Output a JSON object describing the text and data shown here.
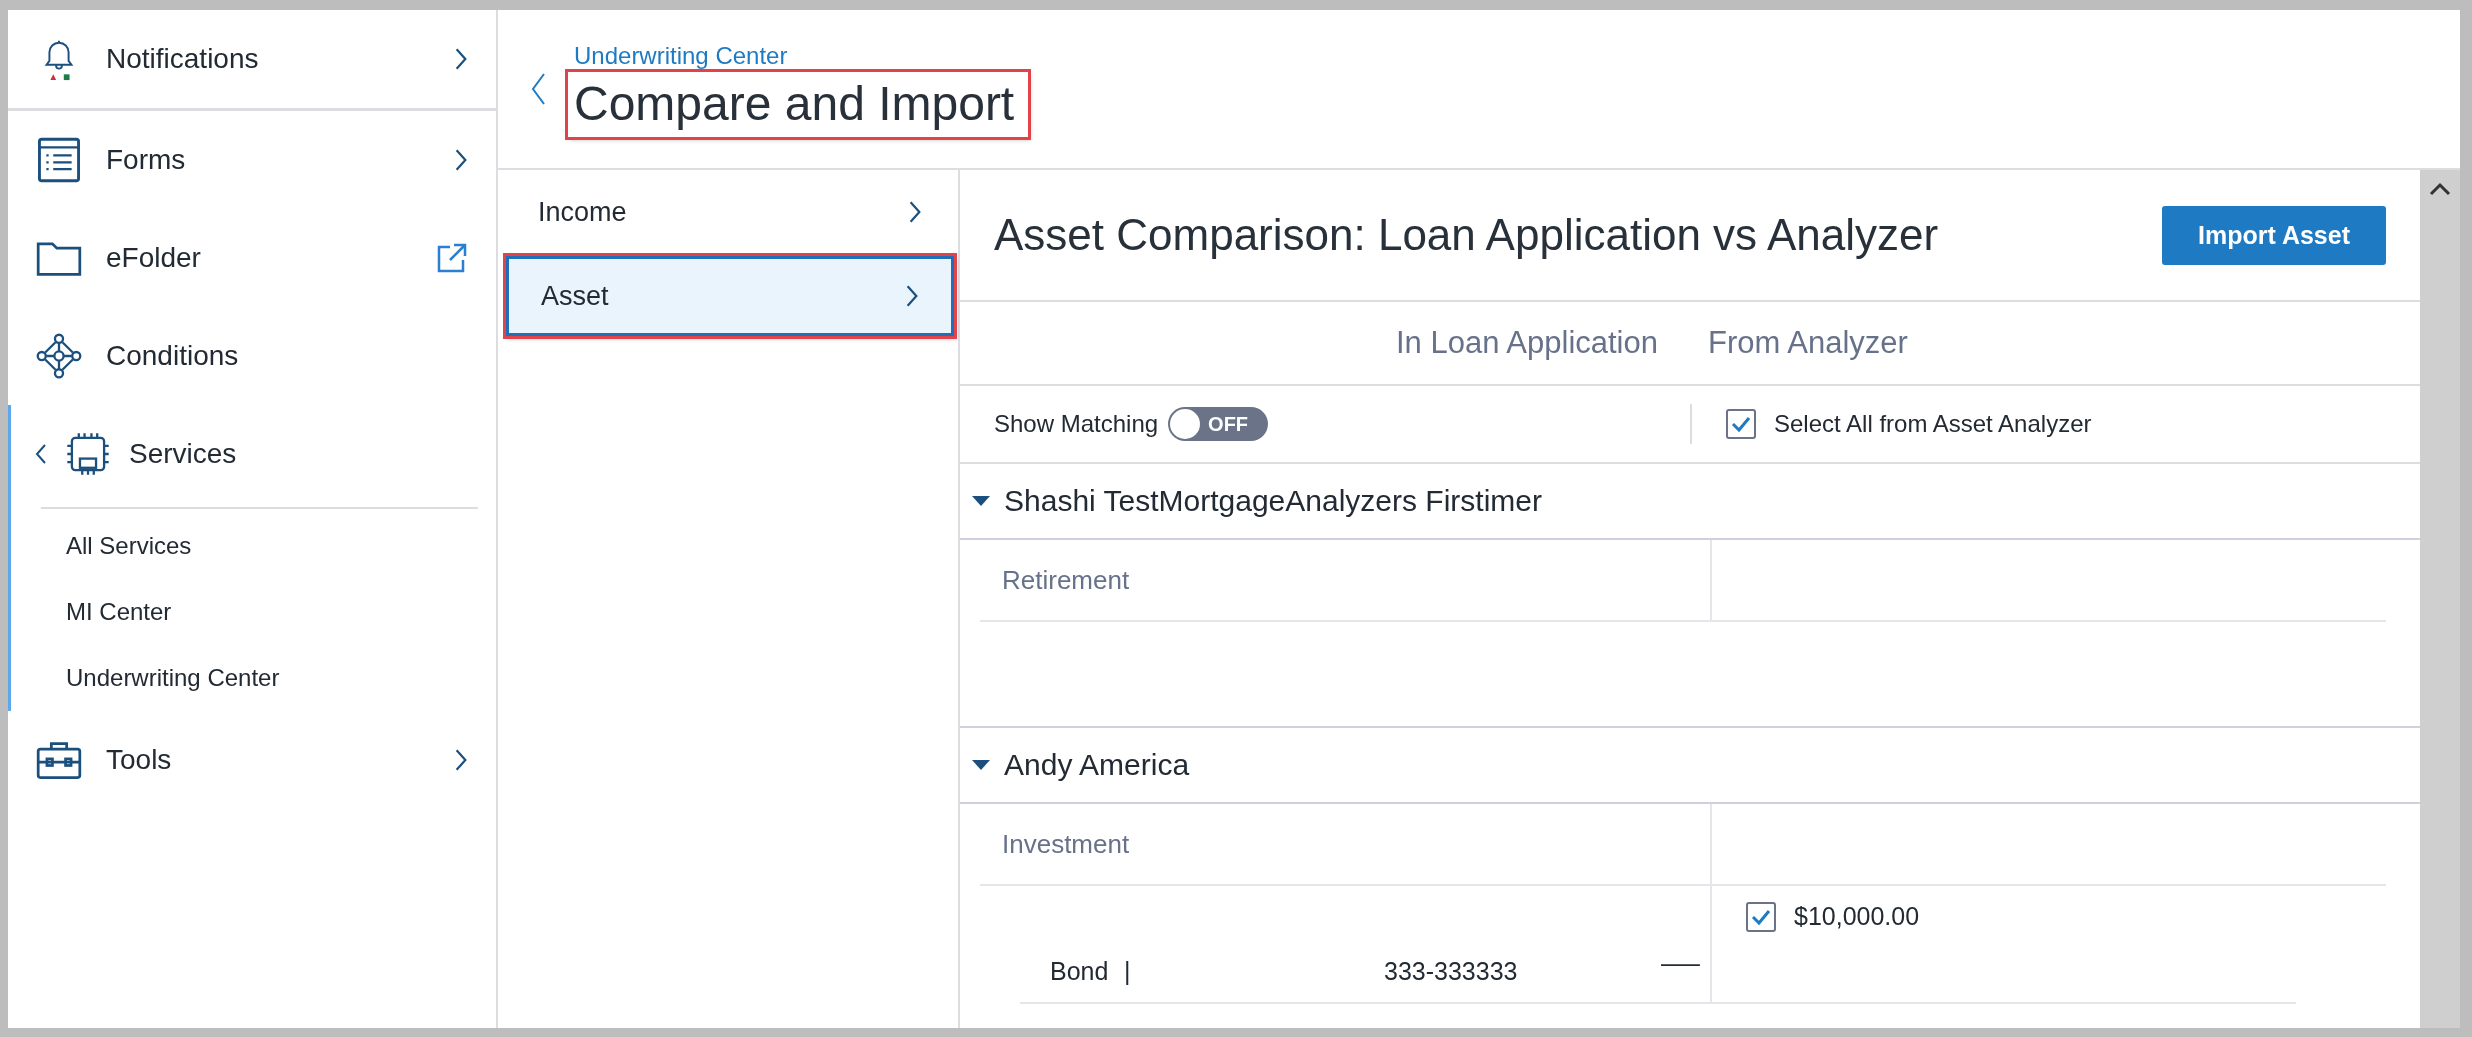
{
  "sidebar": {
    "items": [
      {
        "label": "Notifications",
        "kind": "chevron"
      },
      {
        "label": "Forms",
        "kind": "chevron"
      },
      {
        "label": "eFolder",
        "kind": "external"
      },
      {
        "label": "Conditions",
        "kind": "plain"
      },
      {
        "label": "Services",
        "kind": "group",
        "expanded": true,
        "children": [
          {
            "label": "All Services"
          },
          {
            "label": "MI Center"
          },
          {
            "label": "Underwriting Center"
          }
        ]
      },
      {
        "label": "Tools",
        "kind": "chevron"
      }
    ]
  },
  "header": {
    "breadcrumb": "Underwriting Center",
    "title": "Compare and Import"
  },
  "nav": [
    {
      "label": "Income",
      "selected": false
    },
    {
      "label": "Asset",
      "selected": true
    }
  ],
  "panel": {
    "title": "Asset Comparison: Loan Application vs Analyzer",
    "import_button": "Import Asset",
    "columns": [
      "In Loan Application",
      "From Analyzer"
    ],
    "show_matching": {
      "label": "Show Matching",
      "on": false,
      "state_label": "OFF"
    },
    "select_all": {
      "label": "Select All from Asset Analyzer",
      "checked": true
    },
    "groups": [
      {
        "name": "Shashi TestMortgageAnalyzers Firstimer",
        "expanded": true,
        "categories": [
          {
            "name": "Retirement"
          }
        ]
      },
      {
        "name": "Andy America",
        "expanded": true,
        "categories": [
          {
            "name": "Investment",
            "rows": [
              {
                "name": "Bond",
                "separator": "|",
                "account": "333-333333",
                "loan_value": "—–",
                "checked": true,
                "analyzer_value": "$10,000.00"
              }
            ]
          }
        ]
      }
    ]
  }
}
